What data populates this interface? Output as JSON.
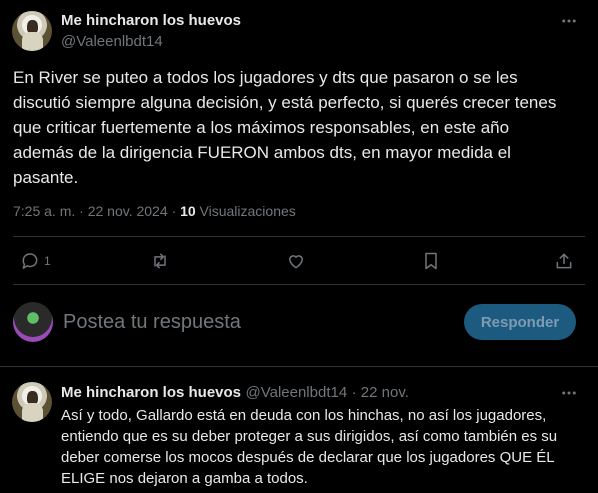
{
  "tweet": {
    "author_name": "Me hincharon los huevos",
    "author_handle": "@Valeenlbdt14",
    "body": "En River se puteo a todos los jugadores y dts que pasaron o se les\ndiscutió siempre alguna decisión, y está perfecto, si querés crecer tenes\nque criticar fuertemente a los máximos responsables, en este año\nademás de la dirigencia FUERON ambos dts, en mayor medida el\npasante.",
    "timestamp": "7:25 a. m. · 22 nov. 2024 ·",
    "views_count": "10",
    "views_label": "Visualizaciones"
  },
  "actions": {
    "reply_count": "1",
    "icons": [
      "reply-icon",
      "retweet-icon",
      "like-icon",
      "bookmark-icon",
      "share-icon"
    ]
  },
  "composer": {
    "placeholder": "Postea tu respuesta",
    "button_label": "Responder"
  },
  "reply": {
    "author_name": "Me hincharon los huevos",
    "author_handle": "@Valeenlbdt14",
    "date": "· 22 nov.",
    "body": "Así y todo, Gallardo está en deuda con los hinchas, no así los jugadores,\nentiendo que es su deber proteger a sus dirigidos, así como también es su\ndeber comerse los mocos después de declarar que los jugadores QUE ÉL\nELIGE nos dejaron a gamba a todos."
  },
  "colors": {
    "background": "#000000",
    "text": "#e7e9ea",
    "muted": "#71767b",
    "divider": "#2f3336",
    "button_bg": "#1d5a80"
  }
}
